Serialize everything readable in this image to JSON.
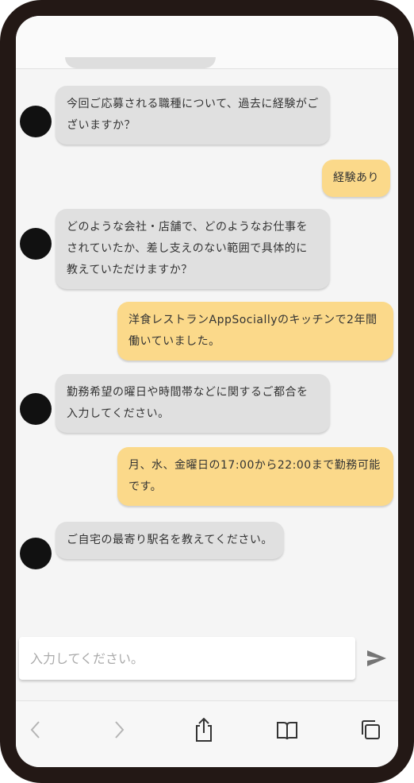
{
  "messages": [
    {
      "from": "bot",
      "text": "今回ご応募される職種について、過去に経験がございますか？"
    },
    {
      "from": "user",
      "text": "経験あり"
    },
    {
      "from": "bot",
      "text": "どのような会社・店舗で、どのようなお仕事をされていたか、差し支えのない範囲で具体的に教えていただけますか？"
    },
    {
      "from": "user",
      "text": "洋食レストランAppSociallyのキッチンで2年間働いていました。"
    },
    {
      "from": "bot",
      "text": "勤務希望の曜日や時間帯などに関するご都合を入力してください。"
    },
    {
      "from": "user",
      "text": "月、水、金曜日の17:00から22:00まで勤務可能です。"
    },
    {
      "from": "bot",
      "text": "ご自宅の最寄り駅名を教えてください。"
    }
  ],
  "input": {
    "placeholder": "入力してください。",
    "value": ""
  },
  "icons": {
    "send": "send-icon",
    "back": "chevron-left-icon",
    "forward": "chevron-right-icon",
    "share": "share-icon",
    "bookmarks": "book-icon",
    "tabs": "tabs-icon"
  },
  "colors": {
    "frame": "#231815",
    "bot_bubble": "#e0e0e0",
    "user_bubble": "#fbd98a",
    "text": "#333333"
  }
}
